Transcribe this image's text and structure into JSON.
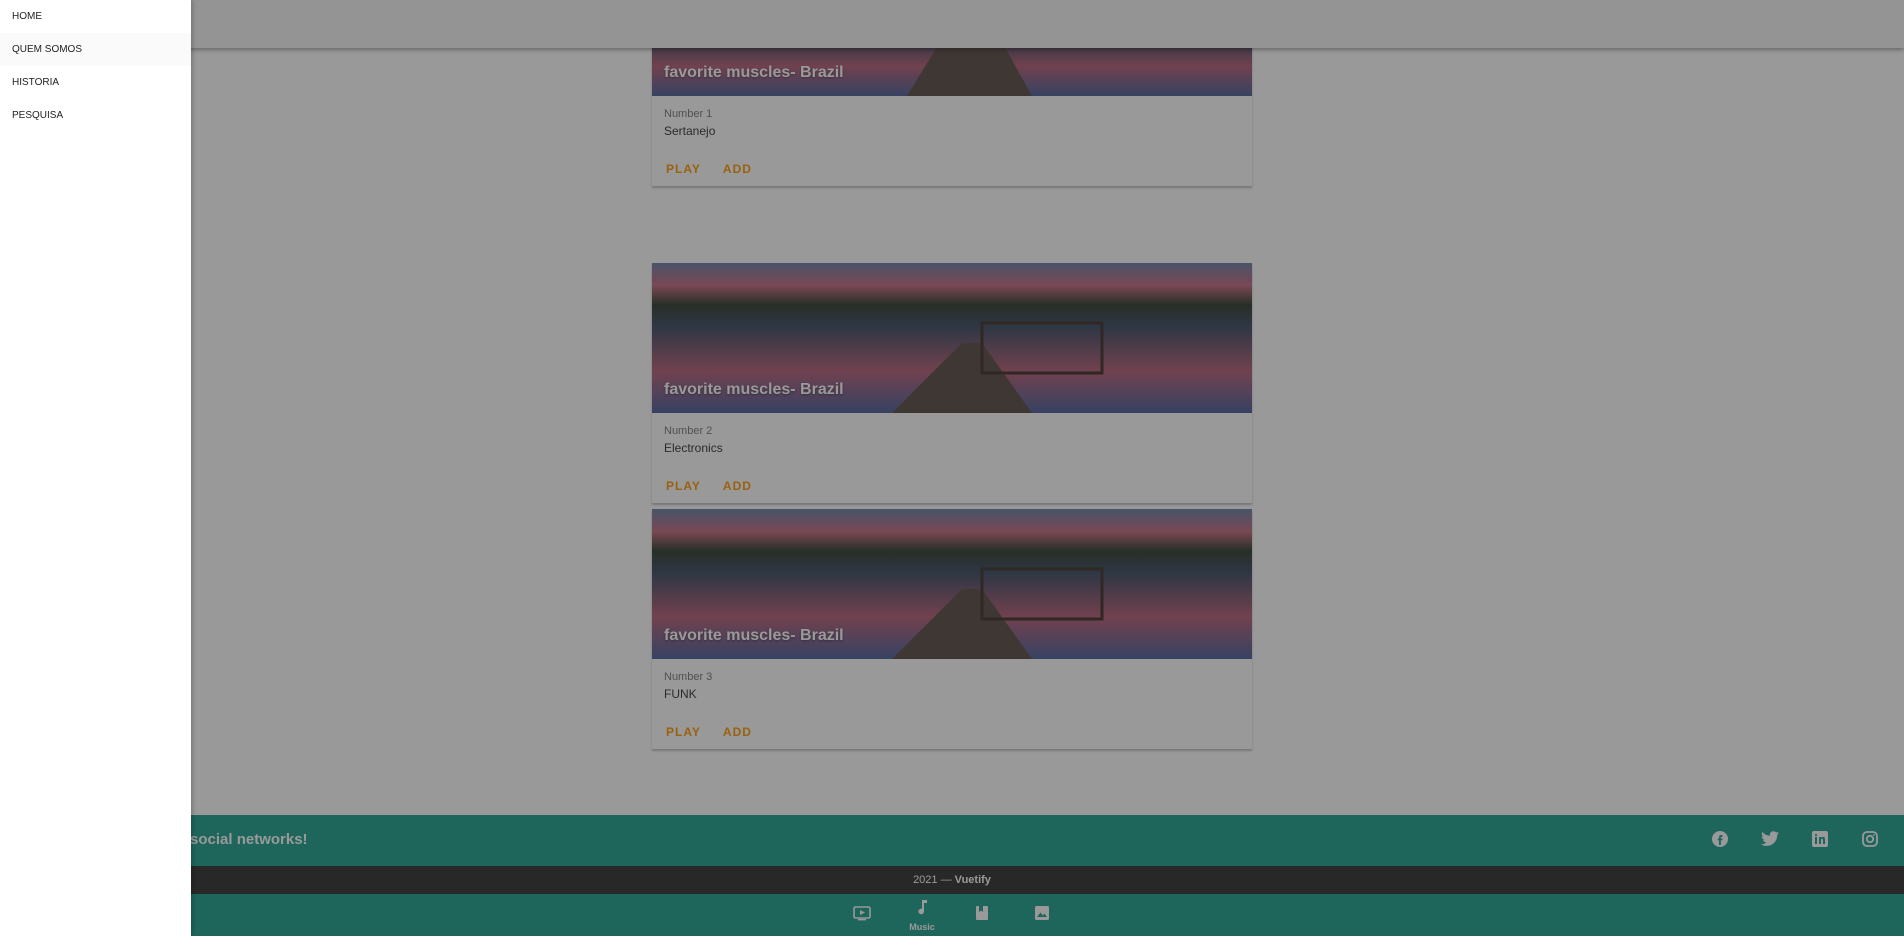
{
  "drawer": {
    "items": [
      {
        "label": "HOME"
      },
      {
        "label": "QUEM SOMOS"
      },
      {
        "label": "HISTORIA"
      },
      {
        "label": "PESQUISA"
      }
    ]
  },
  "cards": [
    {
      "title": "favorite muscles- Brazil",
      "subtitle": "Number 1",
      "text": "Sertanejo",
      "play_label": "PLAY",
      "add_label": "ADD"
    },
    {
      "title": "favorite muscles- Brazil",
      "subtitle": "Number 2",
      "text": "Electronics",
      "play_label": "PLAY",
      "add_label": "ADD"
    },
    {
      "title": "favorite muscles- Brazil",
      "subtitle": "Number 3",
      "text": "FUNK",
      "play_label": "PLAY",
      "add_label": "ADD"
    }
  ],
  "footer": {
    "slogan": "social networks!",
    "icons": [
      "facebook-icon",
      "twitter-icon",
      "linkedin-icon",
      "instagram-icon"
    ],
    "copyright_year": "2021 —",
    "copyright_brand": "Vuetify"
  },
  "bottom_nav": {
    "items": [
      {
        "icon": "video-icon",
        "label": ""
      },
      {
        "icon": "music-icon",
        "label": "Music"
      },
      {
        "icon": "book-icon",
        "label": ""
      },
      {
        "icon": "image-icon",
        "label": ""
      }
    ]
  },
  "colors": {
    "accent": "#ff9800",
    "footer": "#1da18f",
    "copyright_bar": "#2f2f2f",
    "overlay": "#212121"
  }
}
